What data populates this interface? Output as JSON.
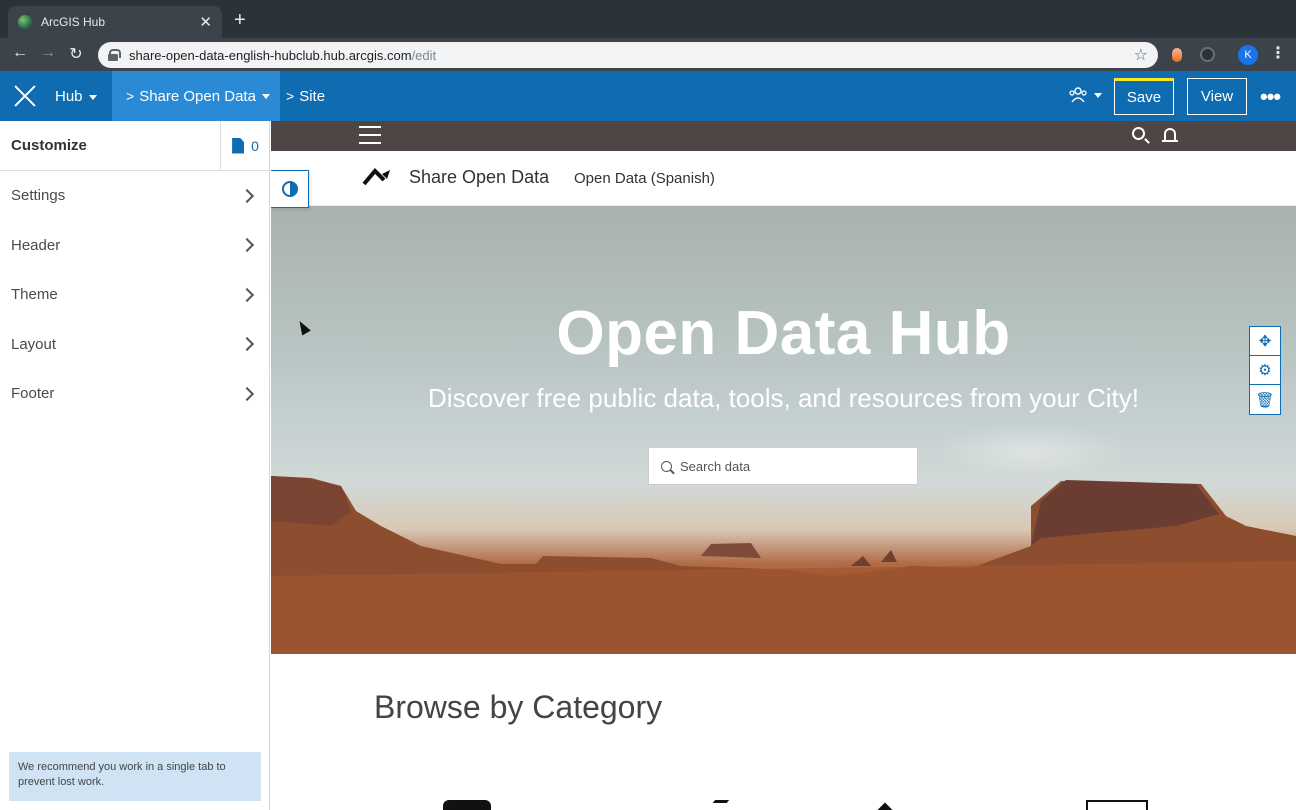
{
  "browser": {
    "tab_title": "ArcGIS Hub",
    "tab_close": "✕",
    "new_tab": "+",
    "url_host": "share-open-data-english-hubclub.hub.arcgis.com",
    "url_path": "/edit",
    "profile_initial": "K",
    "back": "←",
    "forward": "→",
    "reload": "↻",
    "star": "☆",
    "menu": "⋮"
  },
  "appbar": {
    "hub_label": "Hub",
    "site_crumb": "Share Open Data",
    "page_crumb": "Site",
    "save_label": "Save",
    "view_label": "View",
    "more_label": "•••",
    "crumb_chevron": ">",
    "accent_color": "#0f6cb0",
    "save_highlight": "#f8e71c"
  },
  "panel": {
    "title": "Customize",
    "page_count": "0",
    "items": [
      {
        "label": "Settings"
      },
      {
        "label": "Header"
      },
      {
        "label": "Theme"
      },
      {
        "label": "Layout"
      },
      {
        "label": "Footer"
      }
    ],
    "note": "We recommend you work in a single tab to prevent lost work."
  },
  "site": {
    "name": "Share Open Data",
    "nav_link": "Open Data (Spanish)",
    "hero_title": "Open Data Hub",
    "hero_subtitle": "Discover free public data, tools, and resources from your City!",
    "search_placeholder": "Search data",
    "browse_title": "Browse by Category",
    "row_tools": {
      "move": "✥",
      "settings": "⚙",
      "delete": "🗑"
    }
  }
}
